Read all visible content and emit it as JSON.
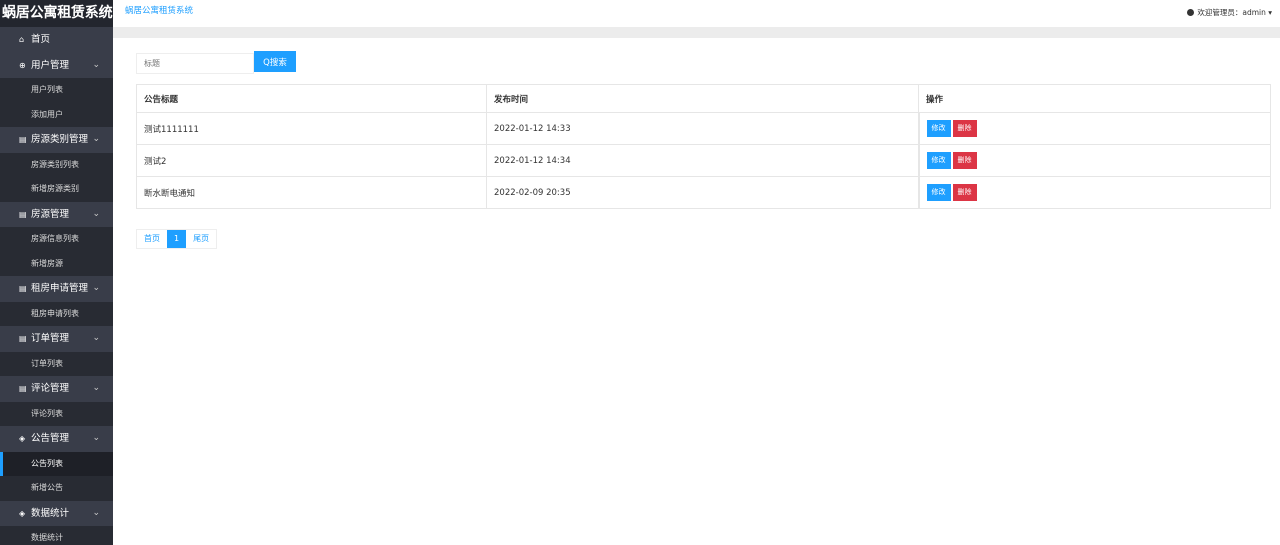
{
  "brand": "蜗居公寓租赁系统",
  "breadcrumb": "蜗居公寓租赁系统",
  "user_label": "欢迎管理员：admin",
  "user_caret": "▾",
  "nav": [
    {
      "icon": "⌂",
      "label": "首页"
    },
    {
      "icon": "⊕",
      "label": "用户管理",
      "chev": "⌄",
      "subs": [
        "用户列表",
        "添加用户"
      ]
    },
    {
      "icon": "▤",
      "label": "房源类别管理",
      "chev": "⌄",
      "subs": [
        "房源类别列表",
        "新增房源类别"
      ]
    },
    {
      "icon": "▤",
      "label": "房源管理",
      "chev": "⌄",
      "subs": [
        "房源信息列表",
        "新增房源"
      ]
    },
    {
      "icon": "▤",
      "label": "租房申请管理",
      "chev": "⌄",
      "subs": [
        "租房申请列表"
      ]
    },
    {
      "icon": "▤",
      "label": "订单管理",
      "chev": "⌄",
      "subs": [
        "订单列表"
      ]
    },
    {
      "icon": "▤",
      "label": "评论管理",
      "chev": "⌄",
      "subs": [
        "评论列表"
      ]
    },
    {
      "icon": "◈",
      "label": "公告管理",
      "chev": "⌄",
      "subs": [
        "公告列表",
        "新增公告"
      ]
    },
    {
      "icon": "◈",
      "label": "数据统计",
      "chev": "⌄",
      "subs": [
        "数据统计"
      ]
    }
  ],
  "search": {
    "placeholder": "标题",
    "button": "Q搜索"
  },
  "table": {
    "headers": [
      "公告标题",
      "发布时间",
      "操作"
    ],
    "rows": [
      {
        "title": "测试1111111",
        "time": "2022-01-12 14:33",
        "edit": "修改",
        "del": "删除"
      },
      {
        "title": "测试2",
        "time": "2022-01-12 14:34",
        "edit": "修改",
        "del": "删除"
      },
      {
        "title": "断水断电通知",
        "time": "2022-02-09 20:35",
        "edit": "修改",
        "del": "删除"
      }
    ]
  },
  "pager": {
    "first": "首页",
    "current": "1",
    "last": "尾页"
  }
}
